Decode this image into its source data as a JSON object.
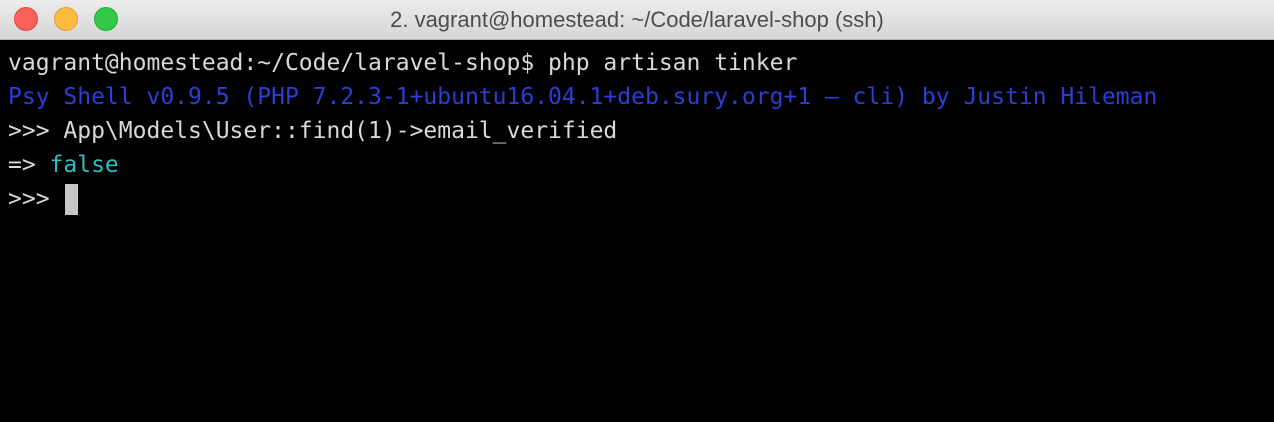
{
  "window": {
    "title": "2. vagrant@homestead: ~/Code/laravel-shop (ssh)",
    "controls": [
      "close",
      "minimize",
      "zoom"
    ]
  },
  "colors": {
    "background": "#000000",
    "text": "#d9d9d9",
    "psy_banner": "#2b3fd4",
    "result_value": "#2cc1c1",
    "cursor": "#c7c7c7"
  },
  "terminal": {
    "prompt_line": "vagrant@homestead:~/Code/laravel-shop$ php artisan tinker",
    "banner": "Psy Shell v0.9.5 (PHP 7.2.3-1+ubuntu16.04.1+deb.sury.org+1 — cli) by Justin Hileman",
    "input_prompt": ">>> ",
    "command": "App\\Models\\User::find(1)->email_verified",
    "result_arrow": "=> ",
    "result_value": "false",
    "current_prompt": ">>> "
  }
}
